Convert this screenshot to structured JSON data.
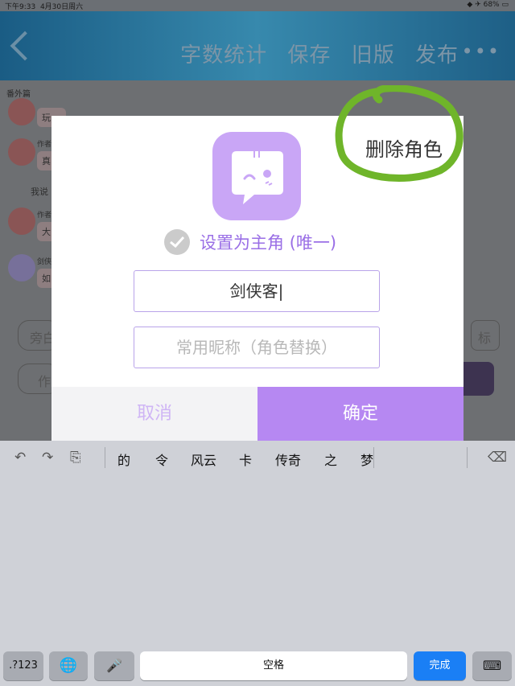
{
  "status_bar": {
    "time": "下午9:33",
    "date": "4月30日周六",
    "battery": "68%"
  },
  "header": {
    "back_label": "<",
    "actions": [
      "字数统计",
      "保存",
      "旧版",
      "发布"
    ],
    "more_label": "•••"
  },
  "editor": {
    "section_label": "番外篇",
    "lines": [
      "玩",
      "作者",
      "真",
      "我说",
      "作者",
      "大",
      "剑侠",
      "如"
    ],
    "inputs": [
      "旁白",
      "作",
      "标"
    ]
  },
  "dialog": {
    "delete_label": "删除角色",
    "set_main_label": "设置为主角 (唯一)",
    "name_value": "剑侠客",
    "nickname_placeholder": "常用昵称（角色替换）",
    "cancel_label": "取消",
    "confirm_label": "确定"
  },
  "keyboard": {
    "candidates": [
      "的",
      "令",
      "风云",
      "卡",
      "传奇",
      "之",
      "梦"
    ],
    "key_123": ".?123",
    "space_label": "空格",
    "done_label": "完成"
  },
  "colors": {
    "accent": "#b688f2",
    "highlight_circle": "#6fb52a",
    "done": "#1a7ff5"
  }
}
